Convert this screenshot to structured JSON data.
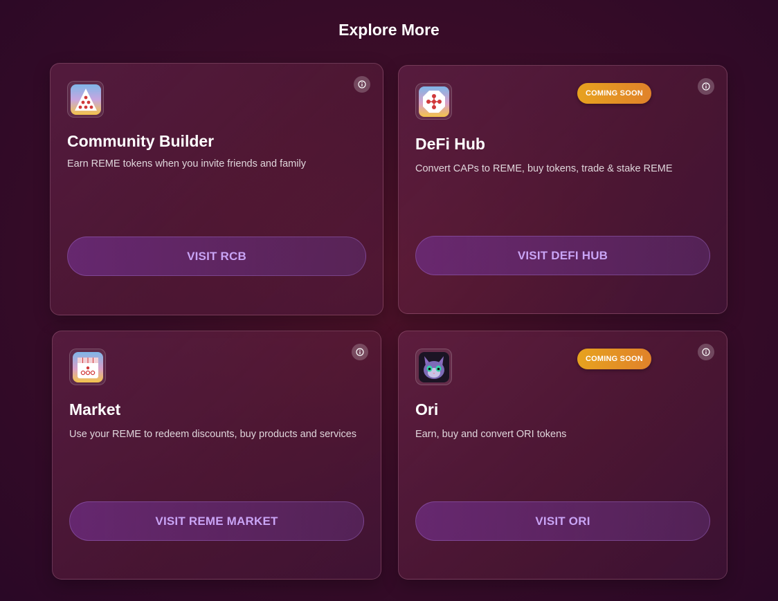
{
  "page": {
    "title": "Explore More"
  },
  "cards": [
    {
      "title": "Community Builder",
      "description": "Earn REME tokens when you invite friends and family",
      "button": "VISIT RCB",
      "icon": "community-builder-icon",
      "badge": ""
    },
    {
      "title": "DeFi Hub",
      "description": "Convert CAPs to REME, buy tokens, trade & stake REME",
      "button": "VISIT DEFI HUB",
      "icon": "defi-hub-icon",
      "badge": "COMING SOON"
    },
    {
      "title": "Market",
      "description": "Use your REME to redeem discounts, buy products and services",
      "button": "VISIT REME MARKET",
      "icon": "market-icon",
      "badge": ""
    },
    {
      "title": "Ori",
      "description": "Earn, buy and convert ORI tokens",
      "button": "VISIT ORI",
      "icon": "ori-cat-icon",
      "badge": "COMING SOON"
    }
  ],
  "colors": {
    "badge": "#e7a21f",
    "button_text": "#c9a4f5",
    "background": "#3a0d28"
  }
}
